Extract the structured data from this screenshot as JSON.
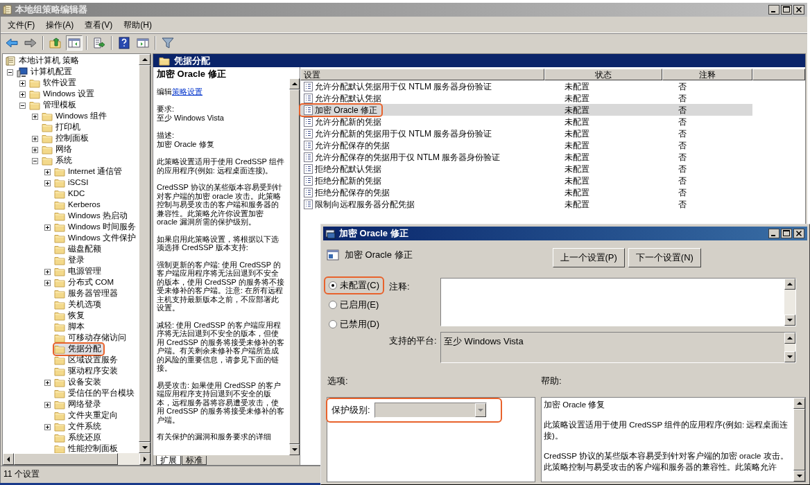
{
  "window": {
    "title": "本地组策略编辑器"
  },
  "menu": [
    "文件(F)",
    "操作(A)",
    "查看(V)",
    "帮助(H)"
  ],
  "toolbar": [
    [
      {
        "kind": "back",
        "pressed": false
      },
      {
        "kind": "forward",
        "pressed": false
      }
    ],
    [
      {
        "kind": "up",
        "pressed": false
      },
      {
        "kind": "tree",
        "pressed": true
      }
    ],
    [
      {
        "kind": "export",
        "pressed": false
      }
    ],
    [
      {
        "kind": "help",
        "pressed": false
      },
      {
        "kind": "pane",
        "pressed": false
      }
    ],
    [
      {
        "kind": "filter",
        "pressed": false
      }
    ]
  ],
  "tree": [
    {
      "label": "本地计算机 策略",
      "selected": false,
      "annotated": false,
      "children": [
        {
          "label": "计算机配置",
          "expanded": true,
          "selected": false,
          "annotated": false,
          "children": [
            {
              "label": "软件设置",
              "expanded": false,
              "selected": false,
              "annotated": false
            },
            {
              "label": "Windows 设置",
              "expanded": false,
              "selected": false,
              "annotated": false
            },
            {
              "label": "管理模板",
              "expanded": true,
              "selected": false,
              "annotated": false,
              "children": [
                {
                  "label": "Windows 组件",
                  "expanded": false,
                  "selected": false,
                  "annotated": false
                },
                {
                  "label": "打印机",
                  "selected": false,
                  "annotated": false
                },
                {
                  "label": "控制面板",
                  "expanded": false,
                  "selected": false,
                  "annotated": false
                },
                {
                  "label": "网络",
                  "expanded": false,
                  "selected": false,
                  "annotated": false
                },
                {
                  "label": "系统",
                  "expanded": true,
                  "selected": false,
                  "annotated": false,
                  "children": [
                    {
                      "label": "Internet 通信管",
                      "expanded": false,
                      "selected": false,
                      "annotated": false
                    },
                    {
                      "label": "iSCSI",
                      "expanded": false,
                      "selected": false,
                      "annotated": false
                    },
                    {
                      "label": "KDC",
                      "selected": false,
                      "annotated": false
                    },
                    {
                      "label": "Kerberos",
                      "selected": false,
                      "annotated": false
                    },
                    {
                      "label": "Windows 热启动",
                      "selected": false,
                      "annotated": false
                    },
                    {
                      "label": "Windows 时间服务",
                      "expanded": false,
                      "selected": false,
                      "annotated": false
                    },
                    {
                      "label": "Windows 文件保护",
                      "selected": false,
                      "annotated": false
                    },
                    {
                      "label": "磁盘配额",
                      "selected": false,
                      "annotated": false
                    },
                    {
                      "label": "登录",
                      "selected": false,
                      "annotated": false
                    },
                    {
                      "label": "电源管理",
                      "expanded": false,
                      "selected": false,
                      "annotated": false
                    },
                    {
                      "label": "分布式 COM",
                      "expanded": false,
                      "selected": false,
                      "annotated": false
                    },
                    {
                      "label": "服务器管理器",
                      "selected": false,
                      "annotated": false
                    },
                    {
                      "label": "关机选项",
                      "selected": false,
                      "annotated": false
                    },
                    {
                      "label": "恢复",
                      "selected": false,
                      "annotated": false
                    },
                    {
                      "label": "脚本",
                      "selected": false,
                      "annotated": false
                    },
                    {
                      "label": "可移动存储访问",
                      "selected": false,
                      "annotated": false
                    },
                    {
                      "label": "凭据分配",
                      "selected": true,
                      "annotated": true
                    },
                    {
                      "label": "区域设置服务",
                      "selected": false,
                      "annotated": false
                    },
                    {
                      "label": "驱动程序安装",
                      "selected": false,
                      "annotated": false
                    },
                    {
                      "label": "设备安装",
                      "expanded": false,
                      "selected": false,
                      "annotated": false
                    },
                    {
                      "label": "受信任的平台模块",
                      "selected": false,
                      "annotated": false
                    },
                    {
                      "label": "网络登录",
                      "expanded": false,
                      "selected": false,
                      "annotated": false
                    },
                    {
                      "label": "文件夹重定向",
                      "selected": false,
                      "annotated": false
                    },
                    {
                      "label": "文件系统",
                      "expanded": false,
                      "selected": false,
                      "annotated": false
                    },
                    {
                      "label": "系统还原",
                      "selected": false,
                      "annotated": false
                    },
                    {
                      "label": "性能控制面板",
                      "selected": false,
                      "annotated": false
                    }
                  ]
                }
              ]
            }
          ]
        }
      ]
    }
  ],
  "details": {
    "heading": "凭据分配",
    "title": "加密 Oracle 修正",
    "edit_prefix": "编辑",
    "edit_link": "策略设置",
    "requirement_label": "要求:",
    "requirement": "至少 Windows Vista",
    "description_label": "描述:",
    "description": "加密 Oracle 修复",
    "paragraphs": [
      "此策略设置适用于使用 CredSSP 组件的应用程序(例如: 远程桌面连接)。",
      "CredSSP 协议的某些版本容易受到针对客户端的加密 oracle 攻击。此策略控制与易受攻击的客户端和服务器的兼容性。此策略允许你设置加密 oracle 漏洞所需的保护级别。",
      "如果启用此策略设置，将根据以下选项选择 CredSSP 版本支持:",
      "强制更新的客户端: 使用 CredSSP 的客户端应用程序将无法回退到不安全的版本，使用 CredSSP 的服务将不接受未修补的客户端。注意: 在所有远程主机支持最新版本之前，不应部署此设置。",
      "减轻: 使用 CredSSP 的客户端应用程序将无法回退到不安全的版本，但使用 CredSSP 的服务将接受未修补的客户端。有关剩余未修补客户端所造成的风险的重要信息，请参见下面的链接。",
      "易受攻击: 如果使用 CredSSP 的客户端应用程序支持回退到不安全的版本，远程服务器将容易遭受攻击，使用 CredSSP 的服务将接受未修补的客户端。",
      "有关保护的漏洞和服务要求的详细"
    ],
    "tabs": [
      {
        "label": "扩展",
        "selected": true
      },
      {
        "label": "标准",
        "selected": false
      }
    ]
  },
  "list": {
    "columns": [
      "设置",
      "状态",
      "注释"
    ],
    "rows": [
      {
        "name": "允许分配默认凭据用于仅 NTLM 服务器身份验证",
        "state": "未配置",
        "comment": "否",
        "selected": false,
        "annotated": false
      },
      {
        "name": "允许分配默认凭据",
        "state": "未配置",
        "comment": "否",
        "selected": false,
        "annotated": false
      },
      {
        "name": "加密 Oracle 修正",
        "state": "未配置",
        "comment": "否",
        "selected": true,
        "annotated": true
      },
      {
        "name": "允许分配新的凭据",
        "state": "未配置",
        "comment": "否",
        "selected": false,
        "annotated": false
      },
      {
        "name": "允许分配新的凭据用于仅 NTLM 服务器身份验证",
        "state": "未配置",
        "comment": "否",
        "selected": false,
        "annotated": false
      },
      {
        "name": "允许分配保存的凭据",
        "state": "未配置",
        "comment": "否",
        "selected": false,
        "annotated": false
      },
      {
        "name": "允许分配保存的凭据用于仅 NTLM 服务器身份验证",
        "state": "未配置",
        "comment": "否",
        "selected": false,
        "annotated": false
      },
      {
        "name": "拒绝分配默认凭据",
        "state": "未配置",
        "comment": "否",
        "selected": false,
        "annotated": false
      },
      {
        "name": "拒绝分配新的凭据",
        "state": "未配置",
        "comment": "否",
        "selected": false,
        "annotated": false
      },
      {
        "name": "拒绝分配保存的凭据",
        "state": "未配置",
        "comment": "否",
        "selected": false,
        "annotated": false
      },
      {
        "name": "限制向远程服务器分配凭据",
        "state": "未配置",
        "comment": "否",
        "selected": false,
        "annotated": false
      }
    ]
  },
  "dialog": {
    "title": "加密 Oracle 修正",
    "policy_name": "加密 Oracle 修正",
    "buttons": [
      "上一个设置(P)",
      "下一个设置(N)"
    ],
    "radios": [
      {
        "label": "未配置(C)",
        "selected": true,
        "annotated": true
      },
      {
        "label": "已启用(E)",
        "selected": false,
        "annotated": false
      },
      {
        "label": "已禁用(D)",
        "selected": false,
        "annotated": false
      }
    ],
    "comment_label": "注释:",
    "platform_label": "支持的平台:",
    "platform": "至少 Windows Vista",
    "options_label": "选项:",
    "help_label": "帮助:",
    "options": [
      {
        "label": "保护级别:",
        "disabled": true,
        "annotated": true
      }
    ],
    "help": [
      "加密 Oracle 修复",
      "此策略设置适用于使用 CredSSP 组件的应用程序(例如: 远程桌面连接)。",
      "CredSSP 协议的某些版本容易受到针对客户端的加密 oracle 攻击。此策略控制与易受攻击的客户端和服务器的兼容性。此策略允许"
    ]
  },
  "status_bar": "11 个设置"
}
